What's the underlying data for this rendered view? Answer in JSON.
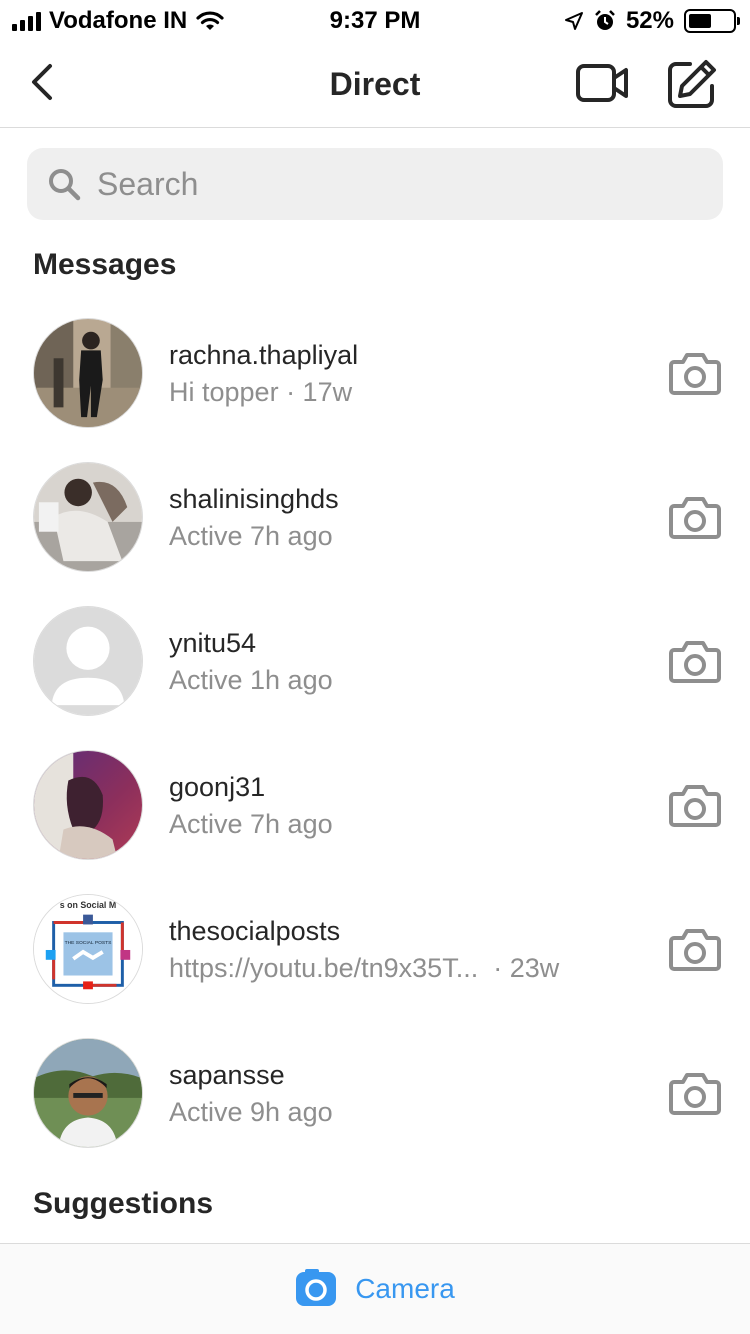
{
  "status_bar": {
    "carrier": "Vodafone IN",
    "time": "9:37 PM",
    "battery": "52%",
    "battery_level": 0.52
  },
  "header": {
    "title": "Direct",
    "back_icon": "chevron-left-icon",
    "video_icon": "video-camera-icon",
    "compose_icon": "new-message-icon"
  },
  "search": {
    "placeholder": "Search"
  },
  "sections": {
    "messages": "Messages",
    "suggestions": "Suggestions"
  },
  "conversations": [
    {
      "username": "rachna.thapliyal",
      "preview": "Hi topper",
      "meta": " · 17w"
    },
    {
      "username": "shalinisinghds",
      "preview": "Active 7h ago",
      "meta": ""
    },
    {
      "username": "ynitu54",
      "preview": "Active 1h ago",
      "meta": ""
    },
    {
      "username": "goonj31",
      "preview": "Active 7h ago",
      "meta": ""
    },
    {
      "username": "thesocialposts",
      "preview": "https://youtu.be/tn9x35T...",
      "meta": "  · 23w"
    },
    {
      "username": "sapansse",
      "preview": "Active 9h ago",
      "meta": ""
    }
  ],
  "avatar_logo_text": {
    "top": "s on Social M",
    "box": "THE SOCIAL POSTS"
  },
  "bottom_bar": {
    "label": "Camera",
    "accent": "#3897f0"
  }
}
